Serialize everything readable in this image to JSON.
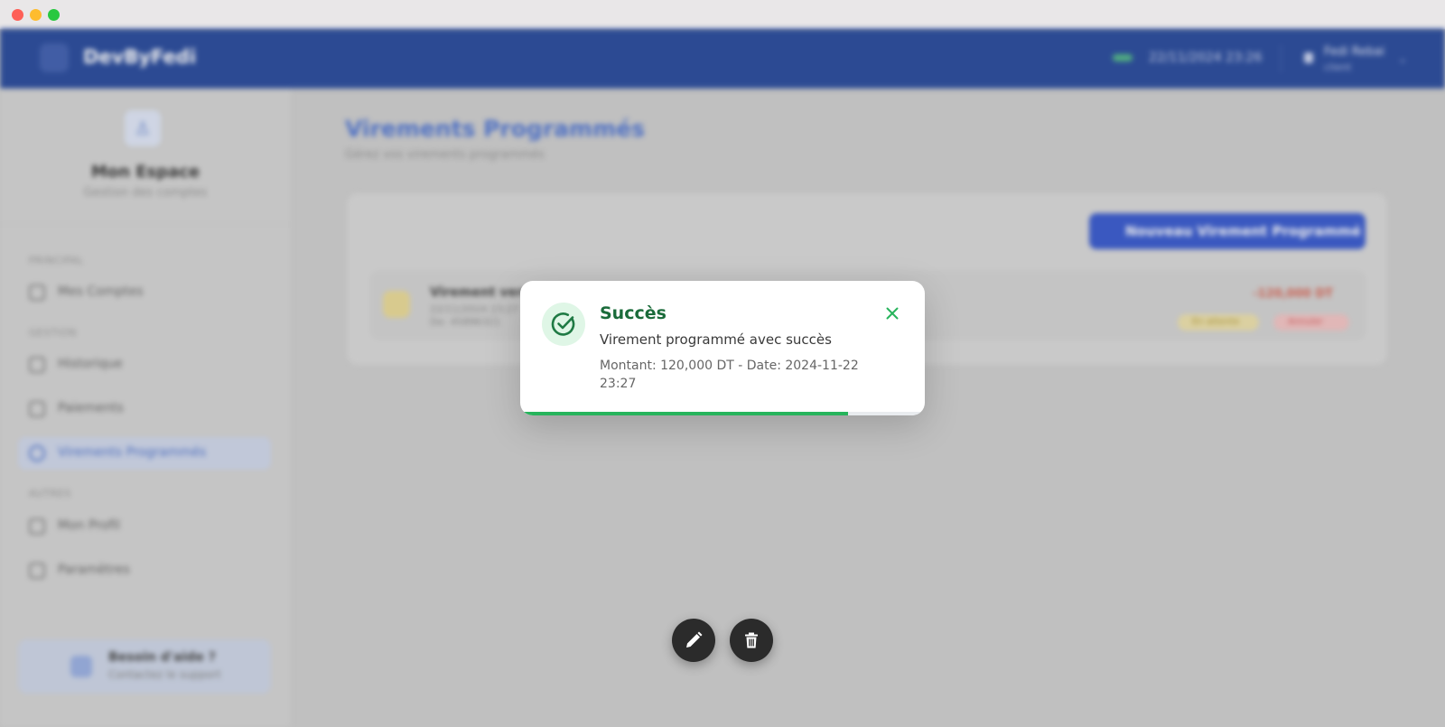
{
  "app": {
    "brand_name": "DevByFedi",
    "datetime": "22/11/2024 23:26",
    "user_name": "Fedi Rebai",
    "user_role": "client"
  },
  "sidebar": {
    "title": "Mon Espace",
    "subtitle": "Gestion des comptes",
    "sections": [
      {
        "label": "PRINCIPAL",
        "items": [
          {
            "label": "Mes Comptes"
          }
        ]
      },
      {
        "label": "GESTION",
        "items": [
          {
            "label": "Historique"
          },
          {
            "label": "Paiements"
          },
          {
            "label": "Virements Programmés",
            "active": true
          }
        ]
      },
      {
        "label": "AUTRES",
        "items": [
          {
            "label": "Mon Profil"
          },
          {
            "label": "Paramètres"
          }
        ]
      }
    ],
    "help": {
      "title": "Besoin d'aide ?",
      "subtitle": "Contactez le support"
    }
  },
  "main": {
    "title": "Virements Programmés",
    "subtitle": "Gérez vos virements programmés",
    "new_button": "Nouveau Virement Programmé",
    "transfer": {
      "title": "Virement vers fedi rebai",
      "line2": "22/11/2024 23:27",
      "line3": "De: 45896321",
      "amount": "-120,000 DT",
      "status_badge": "En attente",
      "cancel_badge": "Annuler"
    }
  },
  "toast": {
    "title": "Succès",
    "message": "Virement programmé avec succès",
    "detail": "Montant: 120,000 DT - Date: 2024-11-22 23:27",
    "progress": 0.81,
    "accent_color": "#27b45c"
  },
  "icons": {
    "toast": "check-circle-icon",
    "close": "close-icon",
    "edit": "pencil-icon",
    "delete": "trash-icon"
  }
}
